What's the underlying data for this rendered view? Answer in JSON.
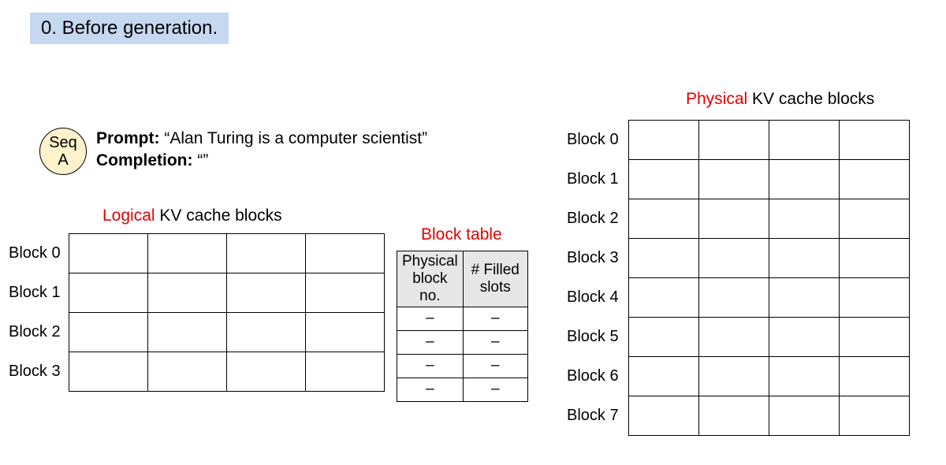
{
  "step_banner": "0. Before generation.",
  "seq_badge": {
    "line1": "Seq",
    "line2": "A"
  },
  "prompt": {
    "prompt_label": "Prompt:",
    "prompt_value": "“Alan Turing is a computer scientist”",
    "completion_label": "Completion:",
    "completion_value": "“”"
  },
  "logical": {
    "title_hl": "Logical",
    "title_rest": " KV cache blocks",
    "rows": [
      "Block 0",
      "Block 1",
      "Block 2",
      "Block 3"
    ],
    "cols": 4
  },
  "blocktable": {
    "title": "Block table",
    "header1_l1": "Physical",
    "header1_l2": "block no.",
    "header2_l1": "# Filled",
    "header2_l2": "slots",
    "rows": [
      {
        "phys": "–",
        "filled": "–"
      },
      {
        "phys": "–",
        "filled": "–"
      },
      {
        "phys": "–",
        "filled": "–"
      },
      {
        "phys": "–",
        "filled": "–"
      }
    ]
  },
  "physical": {
    "title_hl": "Physical",
    "title_rest": " KV cache blocks",
    "rows": [
      "Block 0",
      "Block 1",
      "Block 2",
      "Block 3",
      "Block 4",
      "Block 5",
      "Block 6",
      "Block 7"
    ],
    "cols": 4
  }
}
